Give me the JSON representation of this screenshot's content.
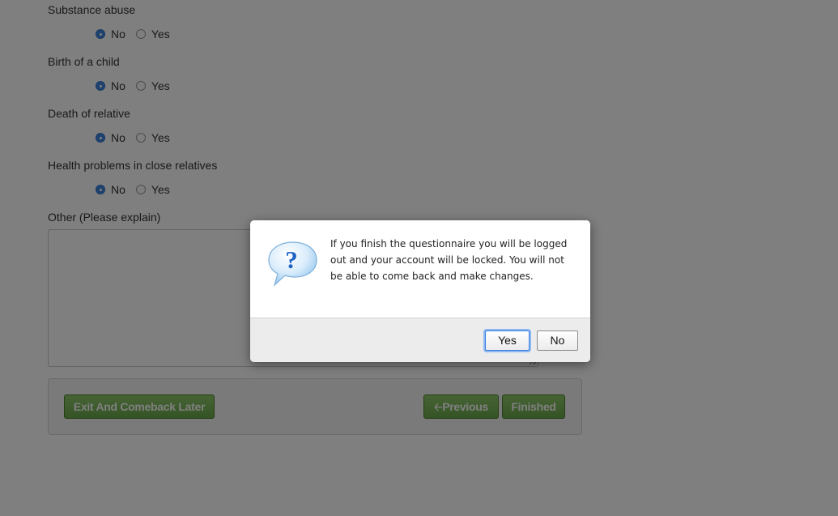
{
  "questions": [
    {
      "label": "Substance abuse",
      "options": [
        {
          "text": "No",
          "checked": true
        },
        {
          "text": "Yes",
          "checked": false
        }
      ]
    },
    {
      "label": "Birth of a child",
      "options": [
        {
          "text": "No",
          "checked": true
        },
        {
          "text": "Yes",
          "checked": false
        }
      ]
    },
    {
      "label": "Death of relative",
      "options": [
        {
          "text": "No",
          "checked": true
        },
        {
          "text": "Yes",
          "checked": false
        }
      ]
    },
    {
      "label": "Health problems in close relatives",
      "options": [
        {
          "text": "No",
          "checked": true
        },
        {
          "text": "Yes",
          "checked": false
        }
      ]
    }
  ],
  "other": {
    "label": "Other (Please explain)",
    "value": ""
  },
  "actions": {
    "exit_label": "Exit And Comeback Later",
    "previous_label": "Previous",
    "previous_icon": "arrow-left-icon",
    "finished_label": "Finished"
  },
  "dialog": {
    "icon": "question-bubble-icon",
    "message": "If you finish the questionnaire you will be logged out and your account will be locked. You will not be able to come back and make changes.",
    "yes_label": "Yes",
    "no_label": "No"
  },
  "colors": {
    "primary_button": "#6aa84a",
    "radio_checked": "#3d86dd",
    "overlay": "rgba(0,0,0,0.5)"
  }
}
